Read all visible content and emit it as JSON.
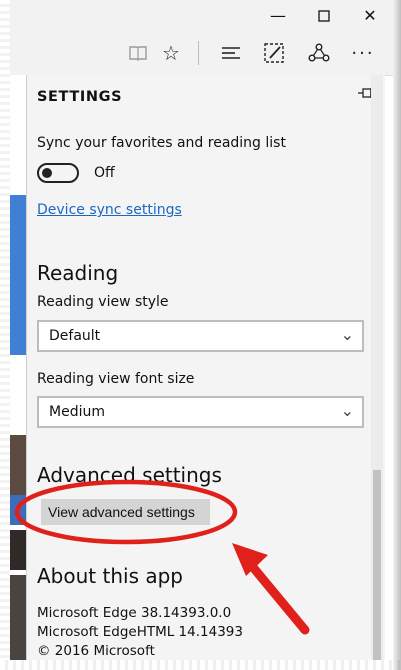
{
  "window": {
    "minimize_icon": "minimize-icon",
    "maximize_icon": "maximize-icon",
    "close_icon": "close-icon"
  },
  "toolbar": {
    "icons": [
      "reading-view-icon",
      "favorite-star-icon",
      "hub-icon",
      "web-note-icon",
      "share-icon",
      "more-icon"
    ]
  },
  "settings": {
    "title": "SETTINGS",
    "pin_icon": "pin-icon",
    "sync_label": "Sync your favorites and reading list",
    "sync_toggle_state": "Off",
    "sync_link": "Device sync settings",
    "reading": {
      "heading": "Reading",
      "view_style_label": "Reading view style",
      "view_style_value": "Default",
      "font_size_label": "Reading view font size",
      "font_size_value": "Medium"
    },
    "advanced": {
      "heading": "Advanced settings",
      "button_label": "View advanced settings"
    },
    "about": {
      "heading": "About this app",
      "lines": [
        "Microsoft Edge 38.14393.0.0",
        "Microsoft EdgeHTML 14.14393",
        "© 2016 Microsoft"
      ]
    }
  },
  "colors": {
    "link": "#1a67c4",
    "annotation_red": "#e0201b",
    "panel_bg": "#f4f4f4"
  }
}
